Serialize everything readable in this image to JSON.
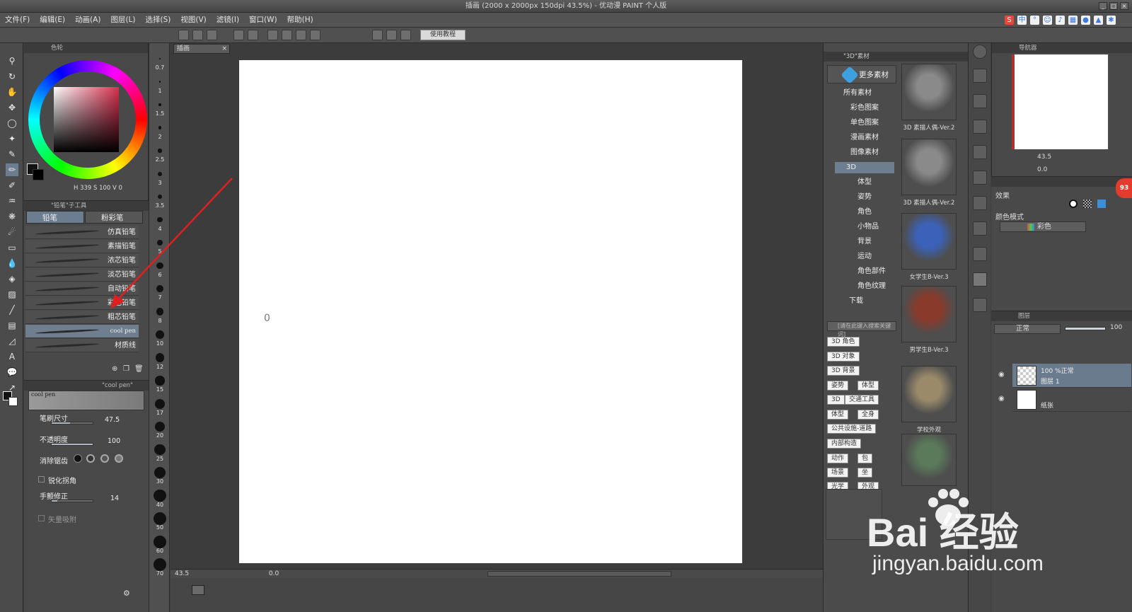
{
  "window": {
    "title": "插画 (2000 x 2000px 150dpi 43.5%) - 优动漫 PAINT 个人版"
  },
  "menu": [
    "文件(F)",
    "编辑(E)",
    "动画(A)",
    "图层(L)",
    "选择(S)",
    "视图(V)",
    "滤镜(I)",
    "窗口(W)",
    "帮助(H)"
  ],
  "toolbar": {
    "tutorial_label": "使用教程"
  },
  "color_panel": {
    "header": "色轮",
    "readout": "H 339  S 100  V  0",
    "accent": "#d8304f"
  },
  "subtool_panel": {
    "header": "\"铅笔\"子工具",
    "tabs": [
      "铅笔",
      "粉彩笔"
    ],
    "brushes": [
      "仿真铅笔",
      "素描铅笔",
      "浓芯铅笔",
      "淡芯铅笔",
      "自动铅笔",
      "彩色铅笔",
      "粗芯铅笔",
      "cool pen",
      "材质线"
    ],
    "selected_brush": "cool pen"
  },
  "size_strip": {
    "labels": [
      "0.7",
      "1",
      "1.5",
      "2",
      "2.5",
      "3",
      "3.5",
      "4",
      "5",
      "6",
      "7",
      "8",
      "10",
      "12",
      "15",
      "17",
      "20",
      "25",
      "30",
      "40",
      "50",
      "60",
      "70"
    ]
  },
  "tool_property": {
    "header": "\"cool pen\"",
    "preview_name": "cool pen",
    "brush_size_label": "笔刷尺寸",
    "brush_size_value": "47.5",
    "opacity_label": "不透明度",
    "opacity_value": "100",
    "antialias_label": "消除锯齿",
    "sharpen_label": "锐化拐角",
    "stabilizer_label": "手颤修正",
    "stabilizer_value": "14",
    "vector_label": "矢量吸附"
  },
  "canvas": {
    "tab_label": "插画",
    "status_zoom": "43.5",
    "status_angle": "0.0",
    "mark": "0"
  },
  "material_panel": {
    "header": "\"3D\"素材",
    "more_label": "更多素材",
    "tree": [
      "所有素材",
      "彩色图案",
      "单色图案",
      "漫画素材",
      "图像素材",
      "3D",
      "体型",
      "姿势",
      "角色",
      "小物品",
      "背景",
      "运动",
      "角色部件",
      "角色纹理",
      "下载"
    ],
    "selected_tree": "3D",
    "search_placeholder": "[请在此键入搜索关键词]",
    "tags": [
      "3D 角色",
      "3D 对象",
      "3D 背景",
      "姿势",
      "体型",
      "3D",
      "交通工具",
      "体型",
      "全身",
      "公共设施-道路",
      "内部构造",
      "动作",
      "包",
      "场景",
      "坐",
      "光学",
      "外观"
    ],
    "thumbs": [
      "3D 素描人偶-Ver.2",
      "3D 素描人偶-Ver.2",
      "女学生B-Ver.3",
      "男学生B-Ver.3",
      "学校外观",
      ""
    ]
  },
  "navigator": {
    "header": "导航器",
    "zoom": "43.5",
    "angle": "0.0"
  },
  "layer_property": {
    "effect_label": "效果",
    "color_mode_label": "颜色模式",
    "color_mode_value": "彩色"
  },
  "layer_panel": {
    "header": "图层",
    "blend_mode": "正常",
    "opacity": "100",
    "layers": [
      {
        "line1": "100 %正常",
        "line2": "图层 1"
      },
      {
        "line1": "",
        "line2": "纸张"
      }
    ]
  },
  "badge": {
    "text": "93"
  },
  "watermark": {
    "brand": "Bai 经验",
    "url": "jingyan.baidu.com"
  }
}
